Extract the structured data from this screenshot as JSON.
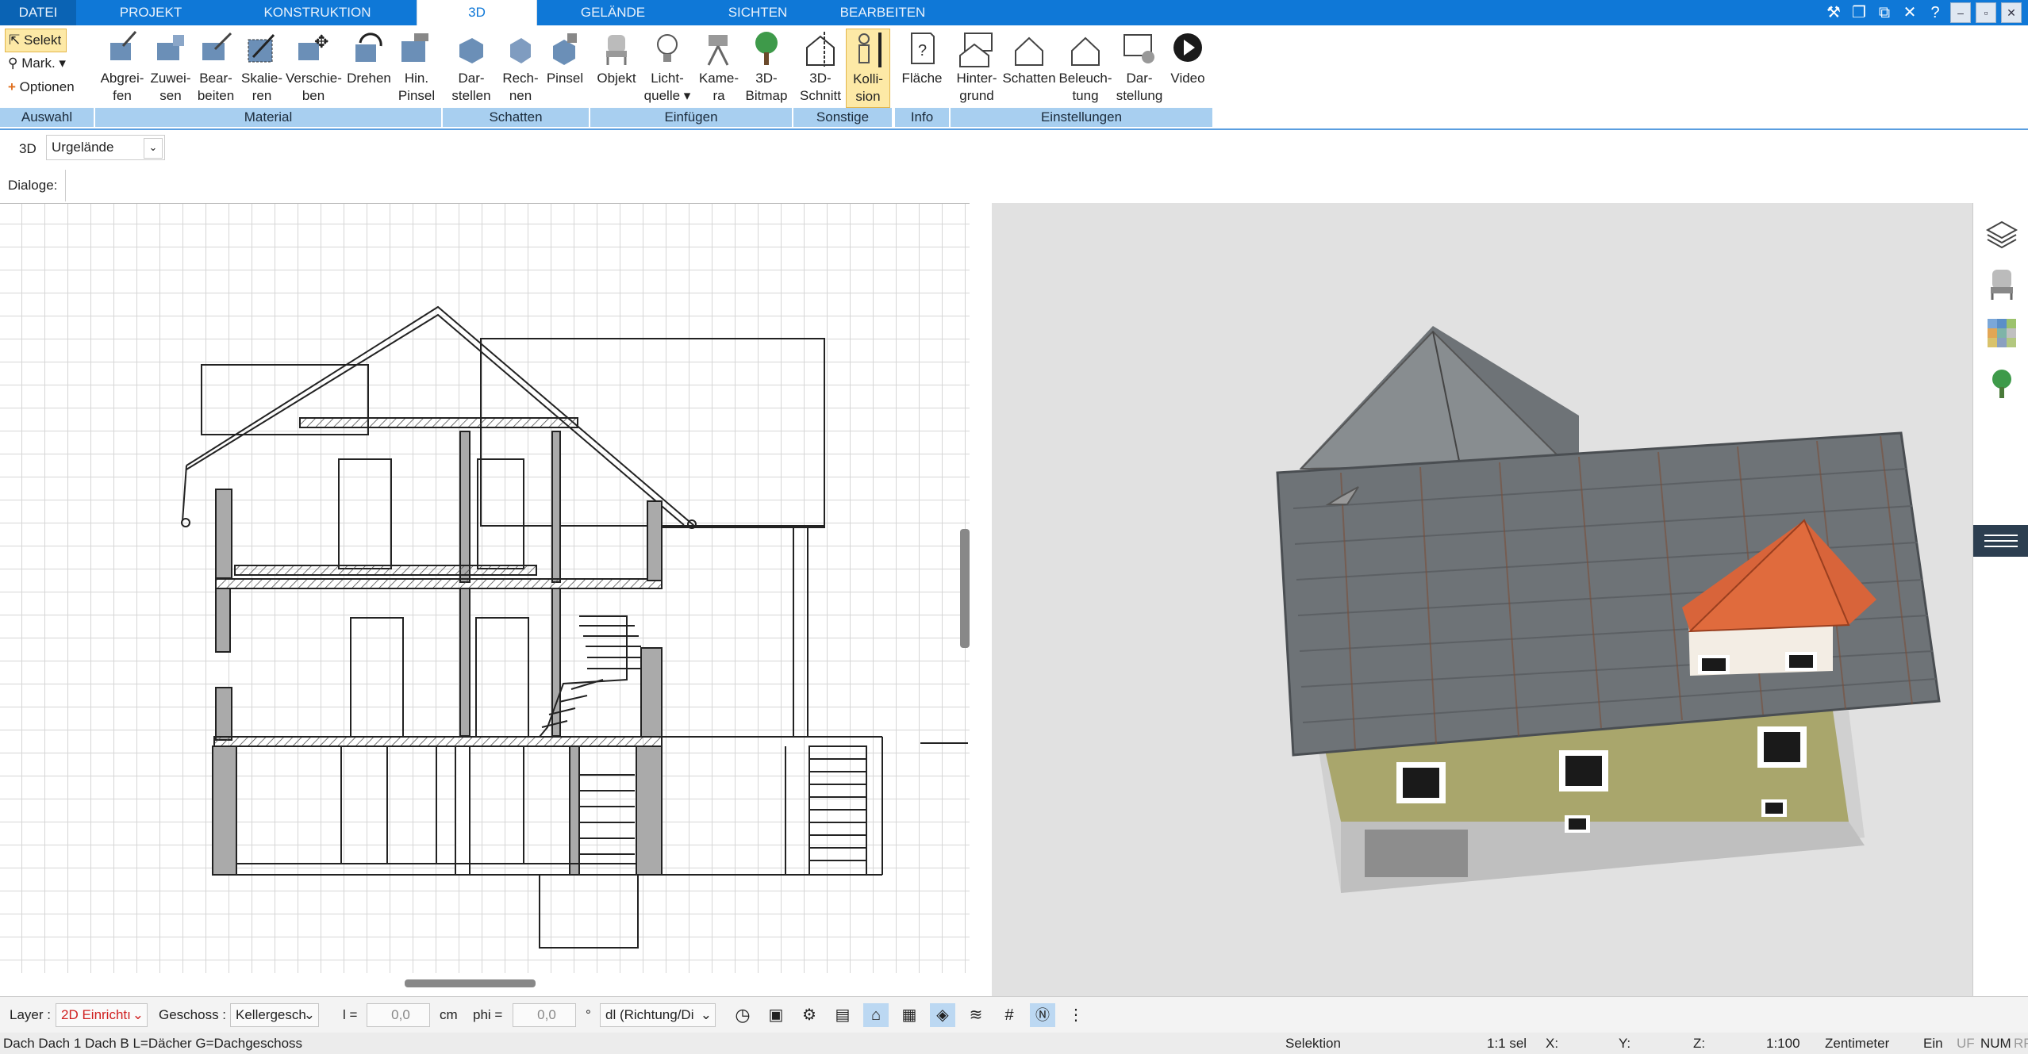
{
  "menu": {
    "datei": "DATEI",
    "projekt": "PROJEKT",
    "konstruktion": "KONSTRUKTION",
    "d3": "3D",
    "gelaende": "GELÄNDE",
    "sichten": "SICHTEN",
    "bearbeiten": "BEARBEITEN"
  },
  "ribbon": {
    "auswahl": {
      "selekt": "Selekt",
      "mark": "Mark.",
      "optionen": "Optionen",
      "group": "Auswahl"
    },
    "material": {
      "group": "Material",
      "items": [
        {
          "l1": "Abgrei-",
          "l2": "fen"
        },
        {
          "l1": "Zuwei-",
          "l2": "sen"
        },
        {
          "l1": "Bear-",
          "l2": "beiten"
        },
        {
          "l1": "Skalie-",
          "l2": "ren"
        },
        {
          "l1": "Verschie-",
          "l2": "ben"
        },
        {
          "l1": "Drehen",
          "l2": ""
        },
        {
          "l1": "Hin.",
          "l2": "Pinsel"
        }
      ]
    },
    "schatten": {
      "group": "Schatten",
      "items": [
        {
          "l1": "Dar-",
          "l2": "stellen"
        },
        {
          "l1": "Rech-",
          "l2": "nen"
        },
        {
          "l1": "Pinsel",
          "l2": ""
        }
      ]
    },
    "einfuegen": {
      "group": "Einfügen",
      "items": [
        {
          "l1": "Objekt",
          "l2": ""
        },
        {
          "l1": "Licht-",
          "l2": "quelle"
        },
        {
          "l1": "Kame-",
          "l2": "ra"
        },
        {
          "l1": "3D-",
          "l2": "Bitmap"
        }
      ]
    },
    "sonstige": {
      "group": "Sonstige",
      "items": [
        {
          "l1": "3D-",
          "l2": "Schnitt"
        },
        {
          "l1": "Kolli-",
          "l2": "sion"
        }
      ]
    },
    "info": {
      "group": "Info",
      "items": [
        {
          "l1": "Fläche",
          "l2": ""
        }
      ]
    },
    "einstellungen": {
      "group": "Einstellungen",
      "items": [
        {
          "l1": "Hinter-",
          "l2": "grund"
        },
        {
          "l1": "Schatten",
          "l2": ""
        },
        {
          "l1": "Beleuch-",
          "l2": "tung"
        },
        {
          "l1": "Dar-",
          "l2": "stellung"
        },
        {
          "l1": "Video",
          "l2": ""
        }
      ]
    }
  },
  "toolbar2": {
    "view_label": "3D",
    "terrain_select": "Urgelände"
  },
  "dialoge": {
    "label": "Dialoge:"
  },
  "bottombar": {
    "layer_label": "Layer :",
    "layer_value": "2D Einrichtı",
    "geschoss_label": "Geschoss :",
    "geschoss_value": "Kellergesch",
    "l_label": "l =",
    "l_value": "0,0",
    "cm": "cm",
    "phi_label": "phi =",
    "phi_value": "0,0",
    "deg": "°",
    "dl_value": "dl (Richtung/Di"
  },
  "status": {
    "left": "Dach Dach 1 Dach B L=Dächer G=Dachgeschoss",
    "selektion": "Selektion",
    "scale_sel": "1:1 sel",
    "x": "X:",
    "y": "Y:",
    "z": "Z:",
    "scale": "1:100",
    "unit": "Zentimeter",
    "ein": "Ein",
    "uf": "UF",
    "num": "NUM",
    "rf": "RF"
  },
  "colors": {
    "accent": "#0f78d7",
    "group_bar": "#a8cff0",
    "selected": "#fde9a6",
    "roof_gray": "#6e7377",
    "roof_orange": "#d8643a",
    "wall_olive": "#a9a66c"
  }
}
